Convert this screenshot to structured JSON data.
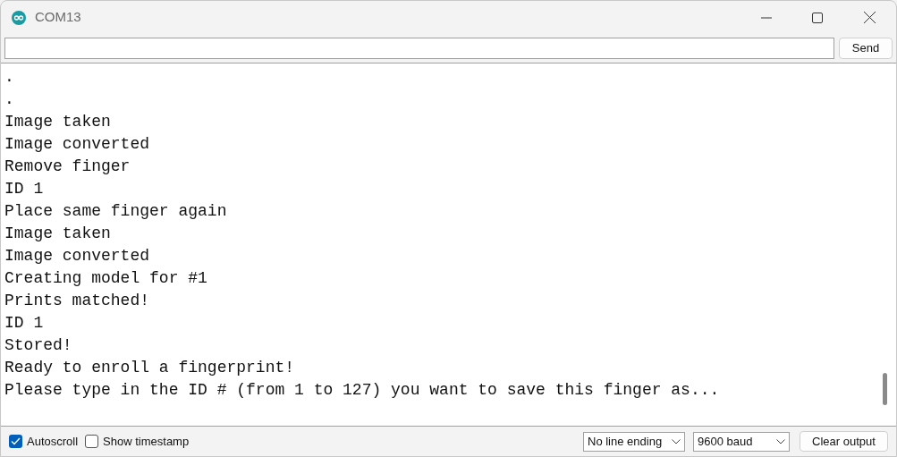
{
  "window": {
    "title": "COM13"
  },
  "send_button": "Send",
  "output_lines": [
    ".",
    ".",
    "Image taken",
    "Image converted",
    "Remove finger",
    "ID 1",
    "Place same finger again",
    "Image taken",
    "Image converted",
    "Creating model for #1",
    "Prints matched!",
    "ID 1",
    "Stored!",
    "Ready to enroll a fingerprint!",
    "Please type in the ID # (from 1 to 127) you want to save this finger as..."
  ],
  "options": [
    {
      "label": "Autoscroll",
      "checked": true
    },
    {
      "label": "Show timestamp",
      "checked": false
    }
  ],
  "dropdowns": [
    {
      "value": "No line ending"
    },
    {
      "value": "9600 baud"
    }
  ],
  "clear_button": "Clear output"
}
